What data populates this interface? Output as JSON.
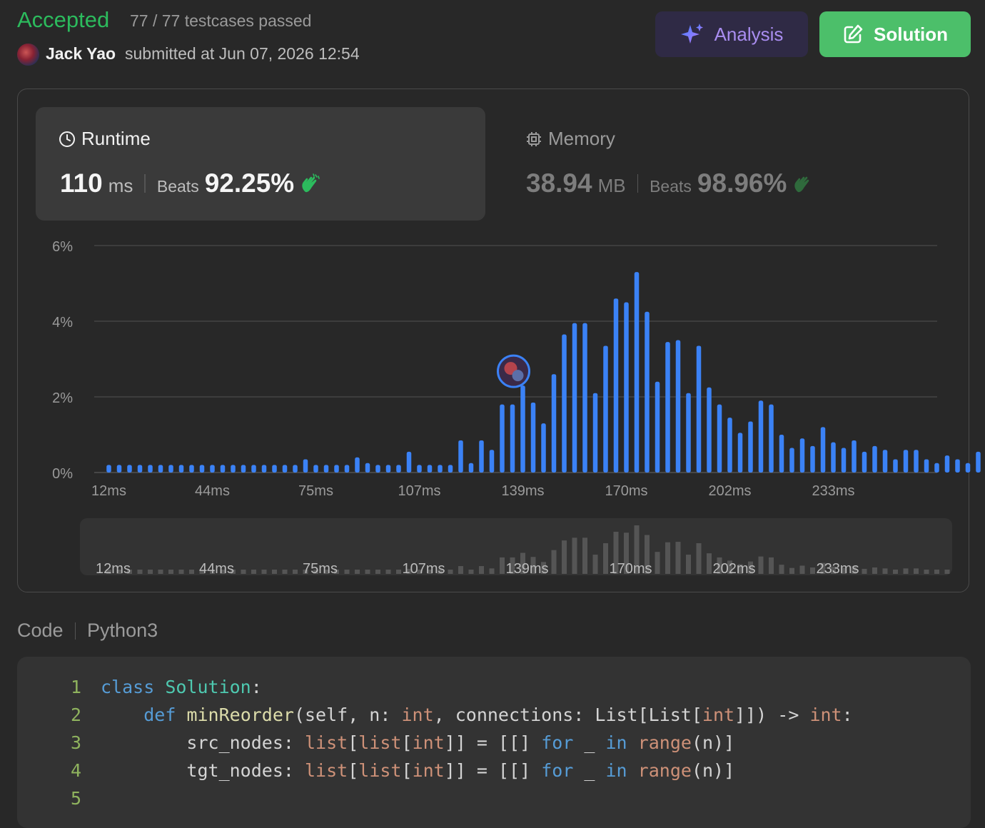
{
  "header": {
    "status": "Accepted",
    "testcases": "77 / 77 testcases passed",
    "user": "Jack Yao",
    "submitted": "submitted at Jun 07, 2026 12:54",
    "analysis_label": "Analysis",
    "solution_label": "Solution"
  },
  "runtime": {
    "label": "Runtime",
    "value": "110",
    "unit": "ms",
    "beats_label": "Beats",
    "beats": "92.25%"
  },
  "memory": {
    "label": "Memory",
    "value": "38.94",
    "unit": "MB",
    "beats_label": "Beats",
    "beats": "98.96%"
  },
  "colors": {
    "accepted": "#2cbb5d",
    "bar": "#3b82f6",
    "mini_bar": "#555555",
    "analysis": "#a98df0",
    "solution_bg": "#4cbf6a"
  },
  "icons": {
    "analysis": "sparkle-icon",
    "solution": "edit-icon",
    "runtime": "clock-icon",
    "memory": "chip-icon",
    "beats": "clap-icon"
  },
  "chart_data": {
    "type": "bar",
    "title": "",
    "xlabel": "",
    "ylabel": "",
    "y_unit": "%",
    "ylim": [
      0,
      6
    ],
    "yticks": [
      "0%",
      "2%",
      "4%",
      "6%"
    ],
    "x_tick_labels": [
      "12ms",
      "44ms",
      "75ms",
      "107ms",
      "139ms",
      "170ms",
      "202ms",
      "233ms"
    ],
    "grid": true,
    "highlight_label": "110ms",
    "series": [
      {
        "values": [
          0.2,
          0.2,
          0.2,
          0.2,
          0.2,
          0.2,
          0.2,
          0.2,
          0.2,
          0.2,
          0.2,
          0.2,
          0.2,
          0.2,
          0.2,
          0.2,
          0.2,
          0.2,
          0.2,
          0.35,
          0.2,
          0.2,
          0.2,
          0.2,
          0.4,
          0.25,
          0.2,
          0.2,
          0.2,
          0.55,
          0.2,
          0.2,
          0.2,
          0.2,
          0.85,
          0.25,
          0.85,
          0.6,
          1.8,
          1.8,
          2.3,
          1.85,
          1.3,
          2.6,
          3.65,
          3.95,
          3.95,
          2.1,
          3.35,
          4.6,
          4.5,
          5.3,
          4.25,
          2.4,
          3.45,
          3.5,
          2.1,
          3.35,
          2.25,
          1.8,
          1.45,
          1.05,
          1.35,
          1.9,
          1.8,
          1.0,
          0.65,
          0.9,
          0.7,
          1.2,
          0.8,
          0.65,
          0.85,
          0.55,
          0.7,
          0.6,
          0.35,
          0.6,
          0.6,
          0.35,
          0.25,
          0.45,
          0.35,
          0.25,
          0.55,
          0.2,
          0.25,
          0.2
        ]
      }
    ]
  },
  "code": {
    "title": "Code",
    "language": "Python3",
    "lines": [
      {
        "n": "1",
        "indent": "",
        "parts": [
          [
            "kw",
            "class "
          ],
          [
            "cls",
            "Solution"
          ],
          [
            "pl",
            ":"
          ]
        ]
      },
      {
        "n": "2",
        "indent": "    ",
        "parts": [
          [
            "kw",
            "def "
          ],
          [
            "fn",
            "minReorder"
          ],
          [
            "pl",
            "(self, n: "
          ],
          [
            "ty",
            "int"
          ],
          [
            "pl",
            ", connections: List[List["
          ],
          [
            "ty",
            "int"
          ],
          [
            "pl",
            "]]) -> "
          ],
          [
            "ty",
            "int"
          ],
          [
            "pl",
            ":"
          ]
        ]
      },
      {
        "n": "3",
        "indent": "        ",
        "parts": [
          [
            "pl",
            "src_nodes: "
          ],
          [
            "ty",
            "list"
          ],
          [
            "pl",
            "["
          ],
          [
            "ty",
            "list"
          ],
          [
            "pl",
            "["
          ],
          [
            "ty",
            "int"
          ],
          [
            "pl",
            "]] = [[] "
          ],
          [
            "kw",
            "for"
          ],
          [
            "pl",
            " _ "
          ],
          [
            "kw",
            "in"
          ],
          [
            "pl",
            " "
          ],
          [
            "ty",
            "range"
          ],
          [
            "pl",
            "(n)]"
          ]
        ]
      },
      {
        "n": "4",
        "indent": "        ",
        "parts": [
          [
            "pl",
            "tgt_nodes: "
          ],
          [
            "ty",
            "list"
          ],
          [
            "pl",
            "["
          ],
          [
            "ty",
            "list"
          ],
          [
            "pl",
            "["
          ],
          [
            "ty",
            "int"
          ],
          [
            "pl",
            "]] = [[] "
          ],
          [
            "kw",
            "for"
          ],
          [
            "pl",
            " _ "
          ],
          [
            "kw",
            "in"
          ],
          [
            "pl",
            " "
          ],
          [
            "ty",
            "range"
          ],
          [
            "pl",
            "(n)]"
          ]
        ]
      },
      {
        "n": "5",
        "indent": "",
        "parts": []
      }
    ]
  }
}
